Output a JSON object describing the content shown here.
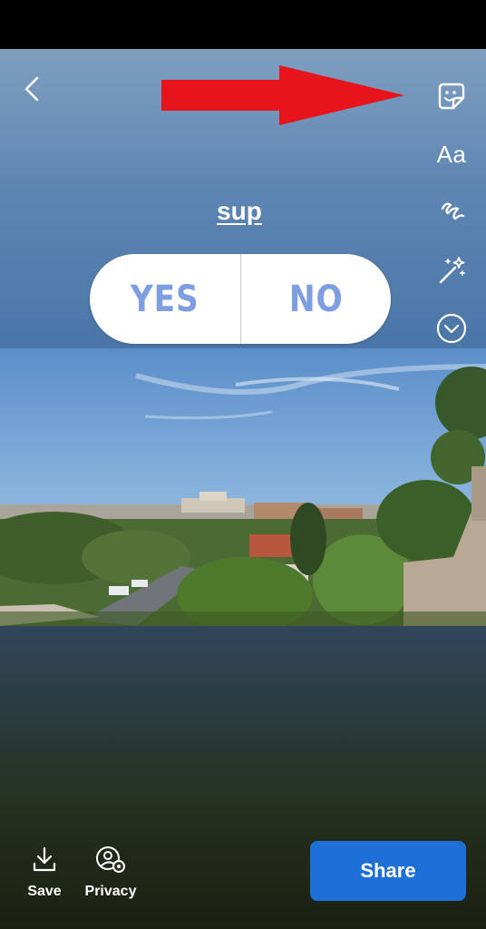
{
  "header": {
    "back_icon": "back-chevron-icon"
  },
  "toolbar": {
    "sticker_icon": "sticker-icon",
    "text_tool_label": "Aa",
    "draw_icon": "squiggle-draw-icon",
    "effects_icon": "magic-wand-icon",
    "more_icon": "chevron-down-circle-icon"
  },
  "annotation": {
    "arrow_color": "#e8141b"
  },
  "poll": {
    "question": "sup",
    "option_yes": "YES",
    "option_no": "NO",
    "option_color": "#7d9ee0"
  },
  "footer": {
    "save_label": "Save",
    "privacy_label": "Privacy",
    "share_label": "Share",
    "share_color": "#1f6fd8"
  }
}
